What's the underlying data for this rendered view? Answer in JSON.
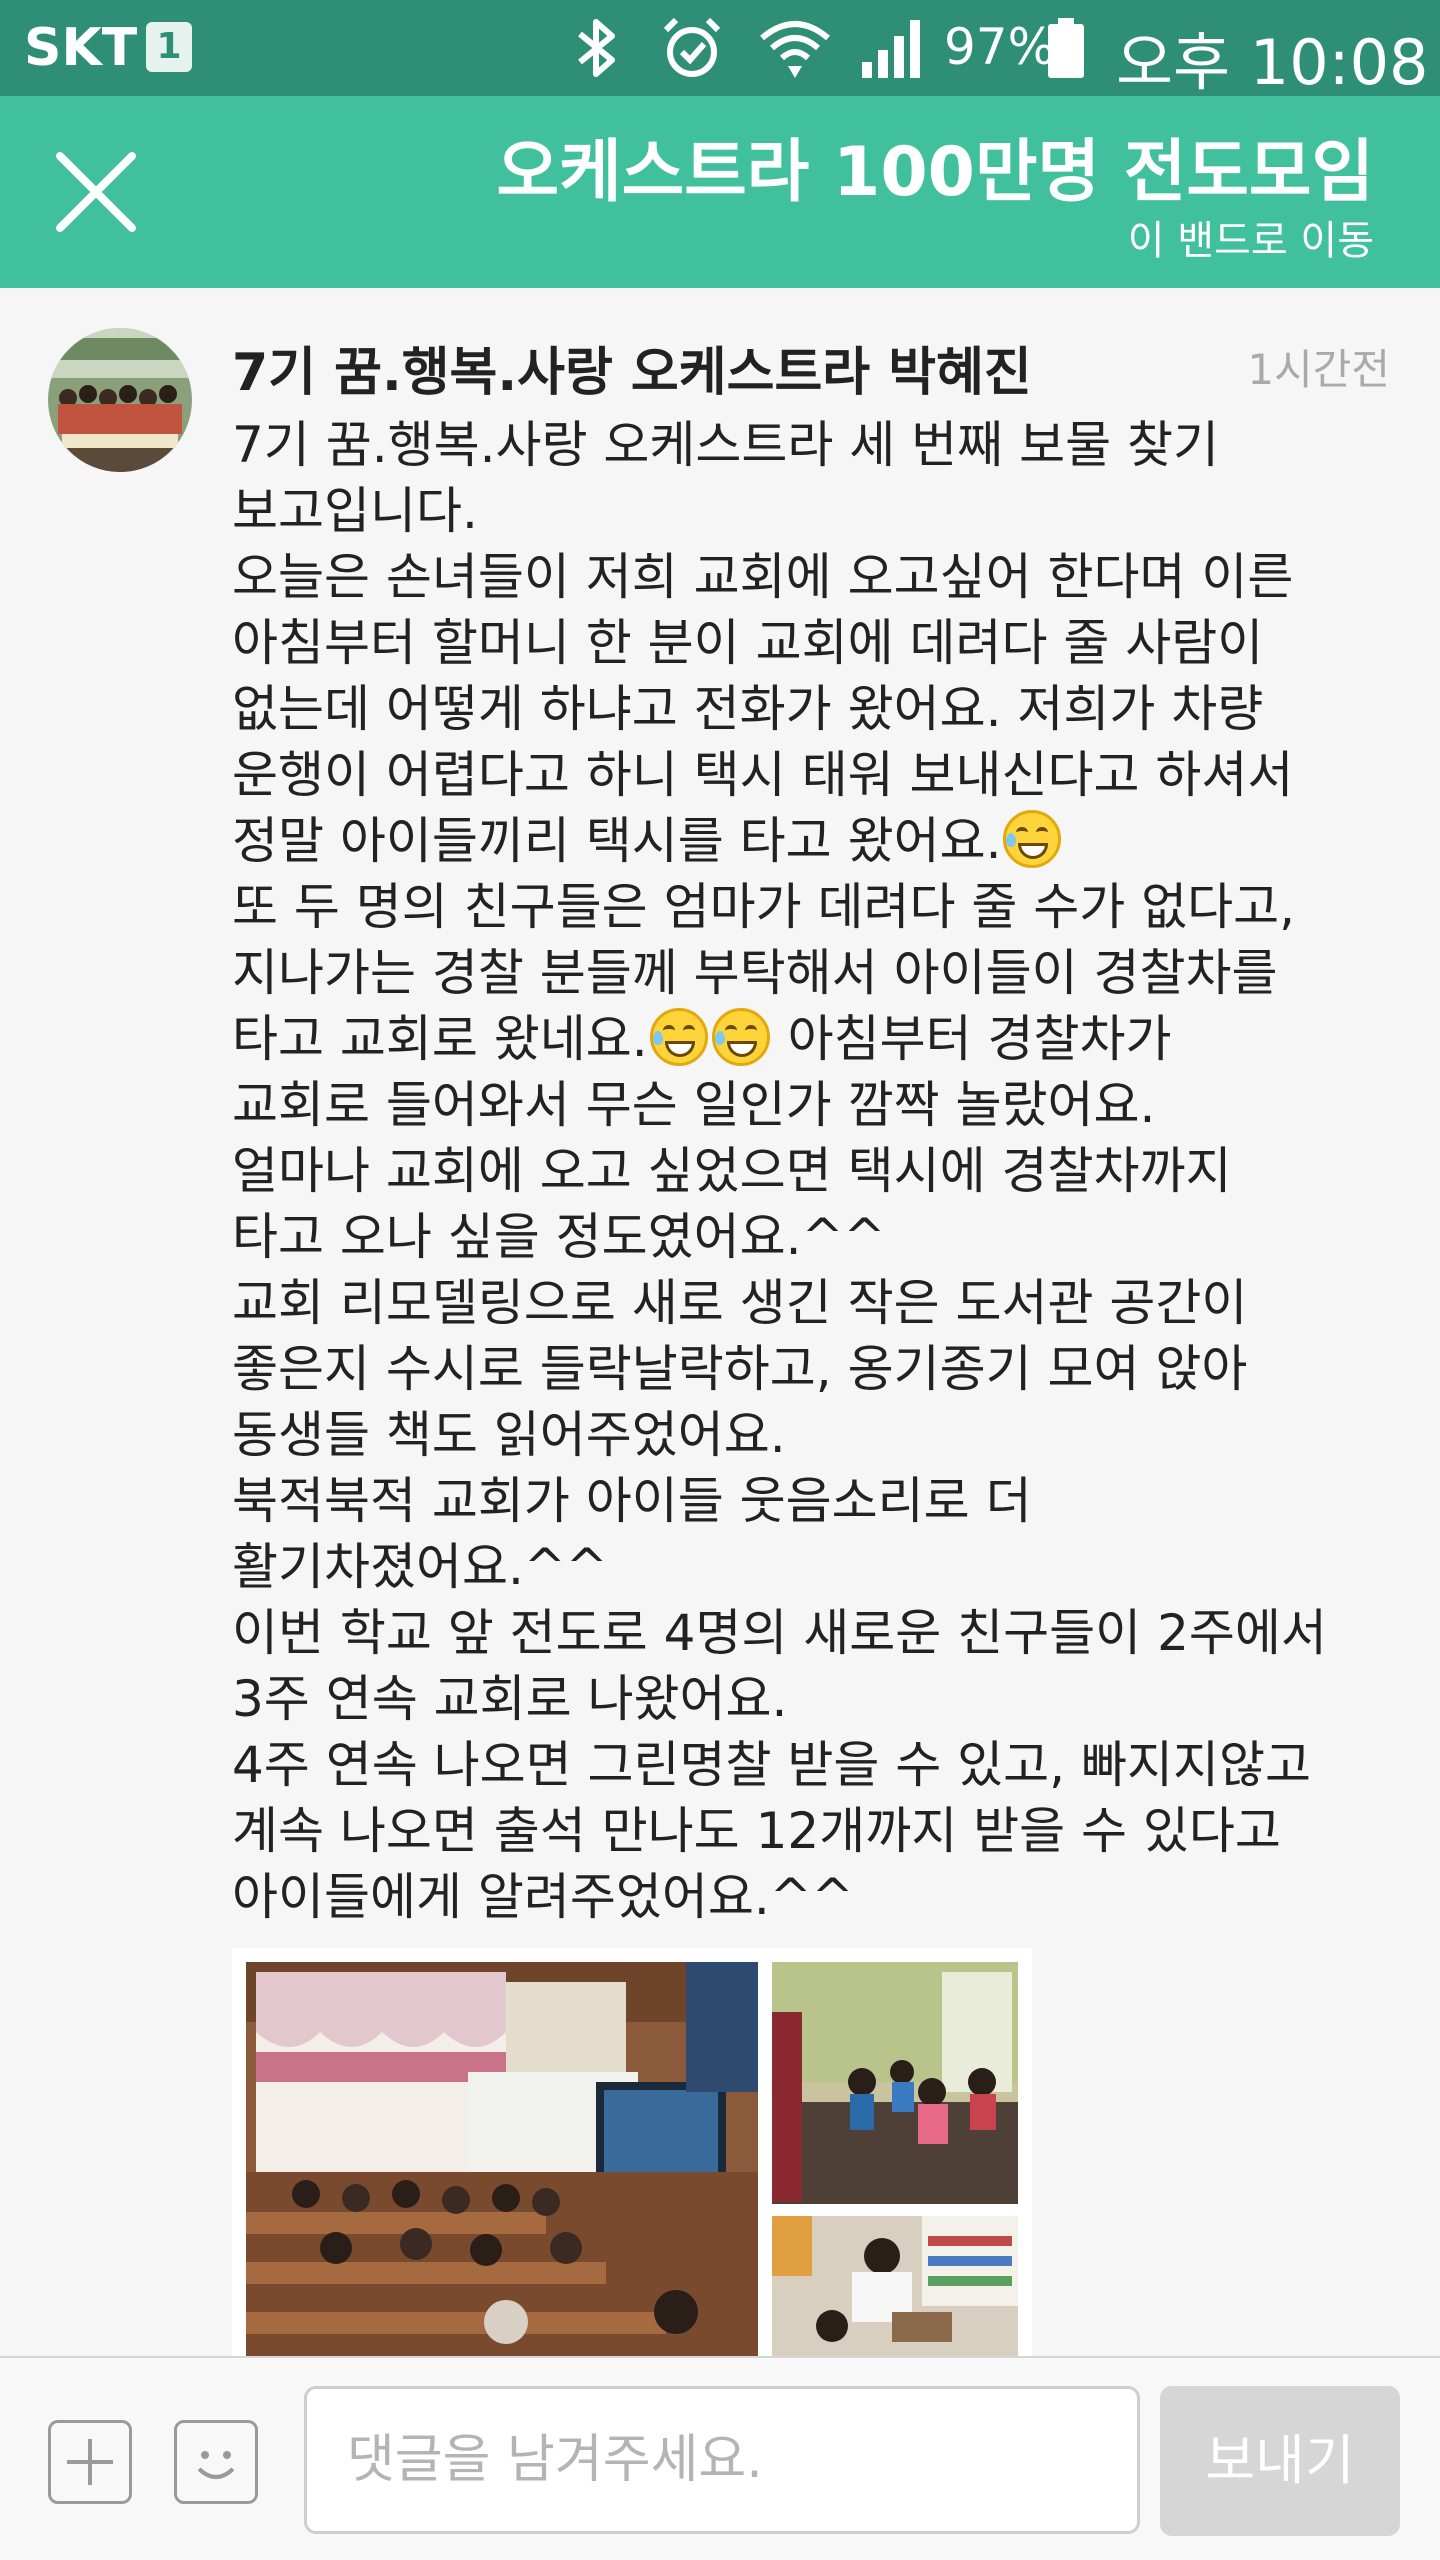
{
  "status_bar": {
    "carrier": "SKT",
    "sim_indicator": "1",
    "battery_percent": "97%",
    "time": "오후 10:08",
    "icons": [
      "bluetooth-icon",
      "alarm-icon",
      "wifi-icon",
      "signal-icon",
      "battery-icon"
    ]
  },
  "header": {
    "title": "오케스트라 100만명 전도모임",
    "subtitle": "이 밴드로 이동",
    "close_icon": "close-icon",
    "color": "#40c09d"
  },
  "post": {
    "author": "7기 꿈.행복.사랑 오케스트라 박혜진",
    "time_ago": "1시간전",
    "body_lines": [
      " 7기 꿈.행복.사랑 오케스트라 세 번째 보물 찾기",
      "보고입니다.",
      "오늘은 손녀들이 저희 교회에 오고싶어 한다며 이른",
      "아침부터 할머니 한 분이 교회에 데려다 줄 사람이",
      "없는데 어떻게 하냐고 전화가 왔어요. 저희가 차량",
      "운행이 어렵다고 하니 택시 태워 보내신다고 하셔서",
      "정말 아이들끼리 택시를 타고 왔어요.",
      "또 두 명의 친구들은 엄마가 데려다 줄 수가 없다고,",
      "지나가는 경찰 분들께 부탁해서 아이들이 경찰차를",
      "타고 교회로 왔네요.",
      " 아침부터 경찰차가",
      "교회로 들어와서 무슨 일인가 깜짝 놀랐어요.",
      "얼마나 교회에 오고 싶었으면 택시에 경찰차까지",
      "타고 오나 싶을 정도였어요.^^",
      "교회 리모델링으로 새로 생긴 작은 도서관 공간이",
      "좋은지 수시로 들락날락하고, 옹기종기 모여 앉아",
      "동생들 책도 읽어주었어요.",
      "북적북적 교회가 아이들 웃음소리로 더",
      "활기차졌어요.^^",
      "이번 학교 앞 전도로 4명의 새로운 친구들이 2주에서",
      "3주 연속 교회로 나왔어요.",
      "4주 연속 나오면 그린명찰 받을 수 있고, 빠지지않고",
      "계속 나오면 출석 만나도 12개까지 받을 수 있다고",
      "아이들에게 알려주었어요.^^"
    ],
    "emoji_icon": "grinning-sweat-emoji-icon"
  },
  "composer": {
    "placeholder": "댓글을 남겨주세요.",
    "send_label": "보내기",
    "add_icon": "plus-icon",
    "sticker_icon": "smiley-icon"
  }
}
